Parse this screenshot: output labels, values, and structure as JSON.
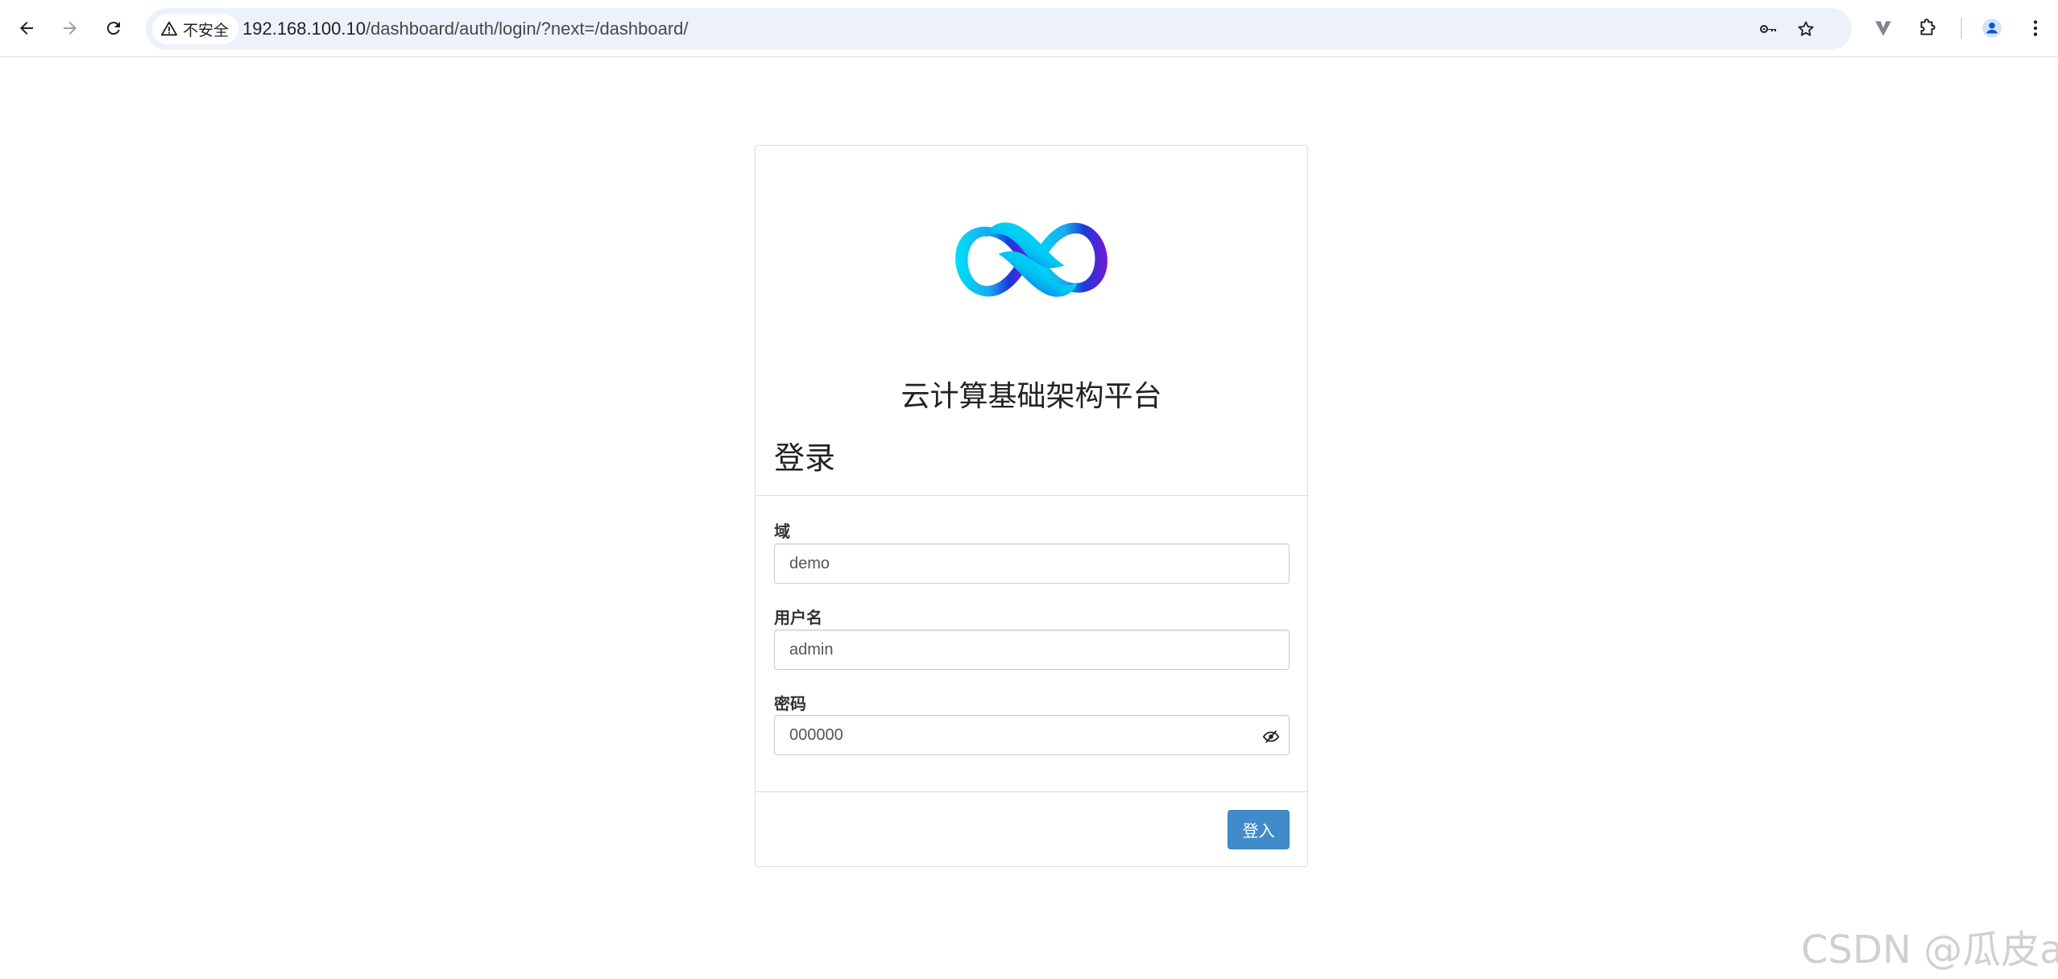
{
  "browser": {
    "security_label": "不安全",
    "url_host": "192.168.100.10",
    "url_path": "/dashboard/auth/login/?next=/dashboard/",
    "icons": {
      "back": "back-arrow-icon",
      "forward": "forward-arrow-icon",
      "reload": "reload-icon",
      "warning": "warning-triangle-icon",
      "key": "key-icon",
      "star": "star-icon",
      "extension_v": "v-extension-icon",
      "extensions": "puzzle-icon",
      "profile": "profile-icon",
      "menu": "kebab-menu-icon"
    }
  },
  "login": {
    "site_title": "云计算基础架构平台",
    "heading": "登录",
    "fields": {
      "domain": {
        "label": "域",
        "value": "demo"
      },
      "username": {
        "label": "用户名",
        "value": "admin"
      },
      "password": {
        "label": "密码",
        "value": "000000"
      }
    },
    "submit_label": "登入"
  },
  "watermark": "CSDN @瓜皮a",
  "colors": {
    "primary": "#428bca",
    "omnibox": "#edf2fa",
    "logo_cyan": "#00d4f5",
    "logo_blue": "#1a3bd8",
    "logo_purple": "#7a16d6"
  }
}
